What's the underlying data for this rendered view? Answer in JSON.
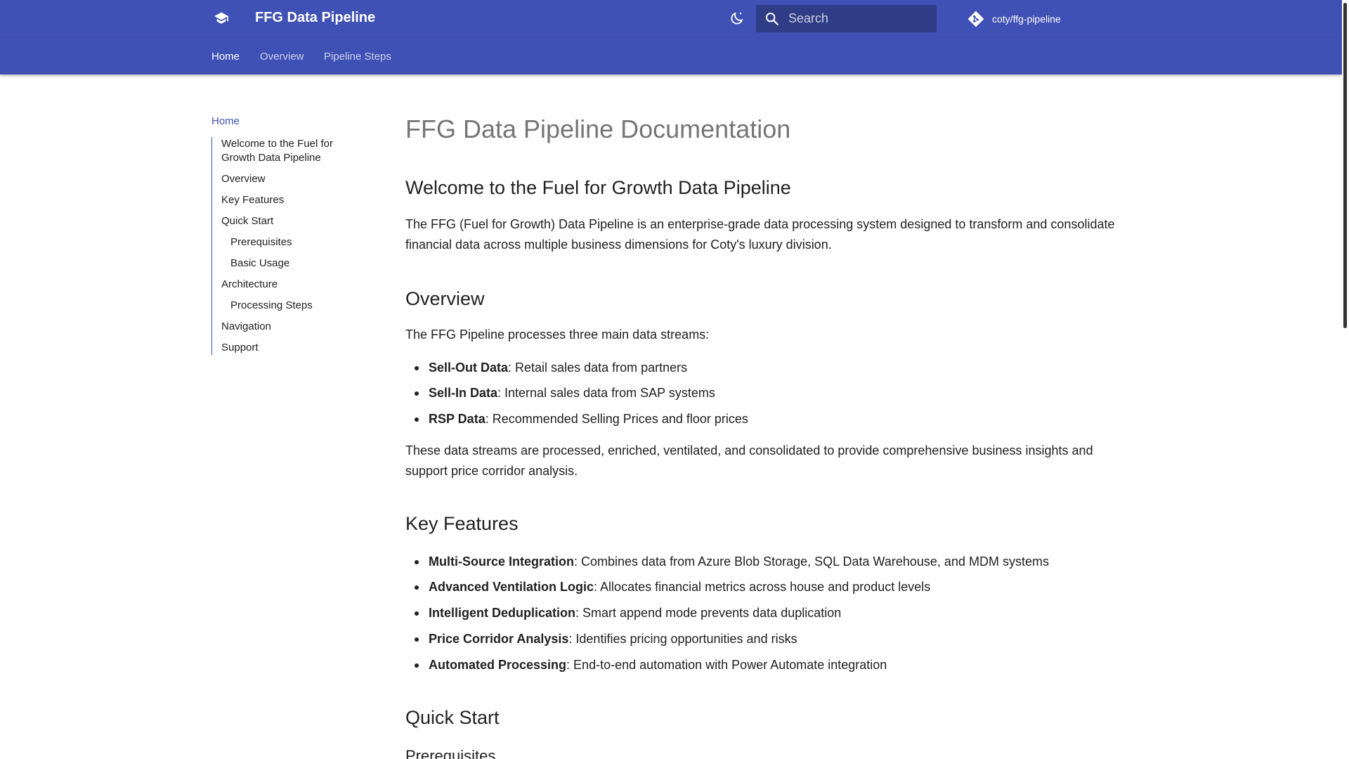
{
  "header": {
    "site_title": "FFG Data Pipeline",
    "repo_name": "coty/ffg-pipeline",
    "search_placeholder": "Search",
    "search_value": ""
  },
  "tabs": [
    {
      "label": "Home",
      "active": true
    },
    {
      "label": "Overview",
      "active": false
    },
    {
      "label": "Pipeline Steps",
      "active": false
    }
  ],
  "sidebar": {
    "home_label": "Home",
    "toc": [
      {
        "label": "Welcome to the Fuel for Growth Data Pipeline",
        "level": 1
      },
      {
        "label": "Overview",
        "level": 1
      },
      {
        "label": "Key Features",
        "level": 1
      },
      {
        "label": "Quick Start",
        "level": 1
      },
      {
        "label": "Prerequisites",
        "level": 2
      },
      {
        "label": "Basic Usage",
        "level": 2
      },
      {
        "label": "Architecture",
        "level": 1
      },
      {
        "label": "Processing Steps",
        "level": 2
      },
      {
        "label": "Navigation",
        "level": 1
      },
      {
        "label": "Support",
        "level": 1
      }
    ]
  },
  "content": {
    "page_title": "FFG Data Pipeline Documentation",
    "welcome_heading": "Welcome to the Fuel for Growth Data Pipeline",
    "welcome_text": "The FFG (Fuel for Growth) Data Pipeline is an enterprise-grade data processing system designed to transform and consolidate financial data across multiple business dimensions for Coty's luxury division.",
    "overview_heading": "Overview",
    "overview_intro": "The FFG Pipeline processes three main data streams:",
    "streams": [
      {
        "term": "Sell-Out Data",
        "desc": ": Retail sales data from partners"
      },
      {
        "term": "Sell-In Data",
        "desc": ": Internal sales data from SAP systems"
      },
      {
        "term": "RSP Data",
        "desc": ": Recommended Selling Prices and floor prices"
      }
    ],
    "overview_outro": "These data streams are processed, enriched, ventilated, and consolidated to provide comprehensive business insights and support price corridor analysis.",
    "features_heading": "Key Features",
    "features": [
      {
        "term": "Multi-Source Integration",
        "desc": ": Combines data from Azure Blob Storage, SQL Data Warehouse, and MDM systems"
      },
      {
        "term": "Advanced Ventilation Logic",
        "desc": ": Allocates financial metrics across house and product levels"
      },
      {
        "term": "Intelligent Deduplication",
        "desc": ": Smart append mode prevents data duplication"
      },
      {
        "term": "Price Corridor Analysis",
        "desc": ": Identifies pricing opportunities and risks"
      },
      {
        "term": "Automated Processing",
        "desc": ": End-to-end automation with Power Automate integration"
      }
    ],
    "quickstart_heading": "Quick Start",
    "prerequisites_heading": "Prerequisites"
  },
  "colors": {
    "primary": "#4051b5",
    "text": "#212121",
    "title_gray": "#757575"
  },
  "icons": {
    "logo": "book-open-icon",
    "palette": "theme-toggle-moon-icon",
    "search": "search-icon",
    "repo": "git-icon"
  }
}
